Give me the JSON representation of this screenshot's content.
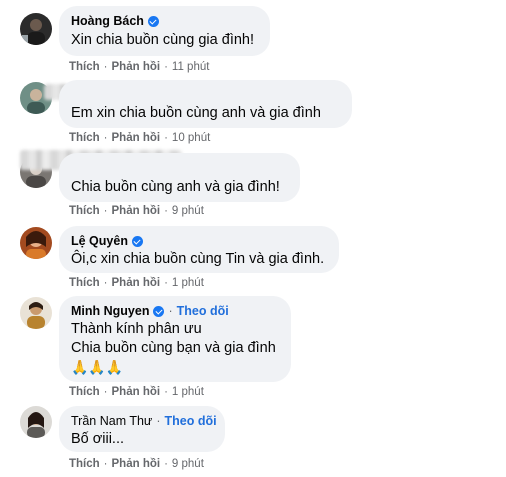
{
  "comments": [
    {
      "author": "Hoàng Bách",
      "verified": true,
      "follow": "",
      "lines": [
        "Xin chia buồn cùng gia đình!"
      ],
      "like": "Thích",
      "reply": "Phản hồi",
      "time": "11 phút"
    },
    {
      "author": "",
      "verified": false,
      "follow": "",
      "lines": [
        "Em xin chia buồn cùng anh và gia đình"
      ],
      "like": "Thích",
      "reply": "Phản hồi",
      "time": "10 phút"
    },
    {
      "author": "",
      "verified": false,
      "follow": "",
      "lines": [
        "Chia buồn cùng anh và gia đình!"
      ],
      "like": "Thích",
      "reply": "Phản hồi",
      "time": "9 phút"
    },
    {
      "author": "Lệ Quyên",
      "verified": true,
      "follow": "",
      "lines": [
        "Ôi,c xin chia buồn cùng Tin và gia đình."
      ],
      "like": "Thích",
      "reply": "Phản hồi",
      "time": "1 phút"
    },
    {
      "author": "Minh Nguyen",
      "verified": true,
      "follow": "Theo dõi",
      "lines": [
        "Thành kính phân ưu",
        "Chia buồn cùng bạn và gia đình",
        "🙏🙏🙏"
      ],
      "like": "Thích",
      "reply": "Phản hồi",
      "time": "1 phút"
    },
    {
      "author": "Trần Nam Thư",
      "verified": false,
      "follow": "Theo dõi",
      "lines": [
        "Bố ơiii..."
      ],
      "like": "Thích",
      "reply": "Phản hồi",
      "time": "9 phút"
    }
  ],
  "colors": {
    "bubble": "#f0f2f5",
    "verified": "#1877f2",
    "follow": "#216fdb",
    "meta": "#65676b"
  },
  "icons": {
    "verified": "verified-badge-icon",
    "prayer": "folded-hands-emoji"
  }
}
